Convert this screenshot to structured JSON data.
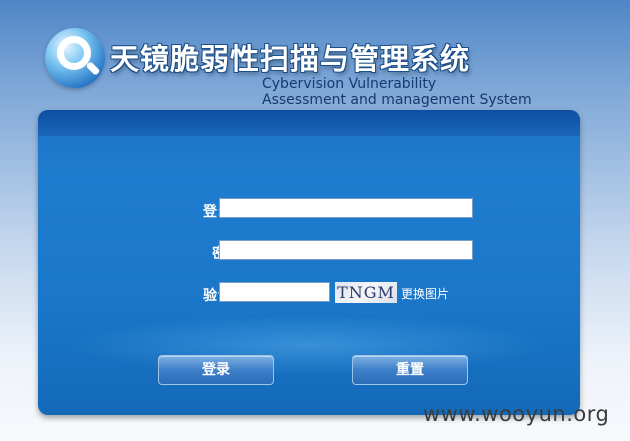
{
  "header": {
    "title_cn": "天镜脆弱性扫描与管理系统",
    "title_en_line1": "Cybervision Vulnerability",
    "title_en_line2": "Assessment and management System"
  },
  "login_form": {
    "username_label": "登录名",
    "password_label": "密 码",
    "captcha_label": "验证码",
    "username_value": "",
    "password_value": "",
    "captcha_value": "",
    "captcha_text": "TNGM",
    "change_image_link": "更换图片",
    "login_button": "登录",
    "reset_button": "重置"
  },
  "watermark": "www.wooyun.org",
  "colors": {
    "panel_blue": "#1976c8",
    "title_outline": "#1b4f8a",
    "button_blue": "#3d7fc9"
  }
}
